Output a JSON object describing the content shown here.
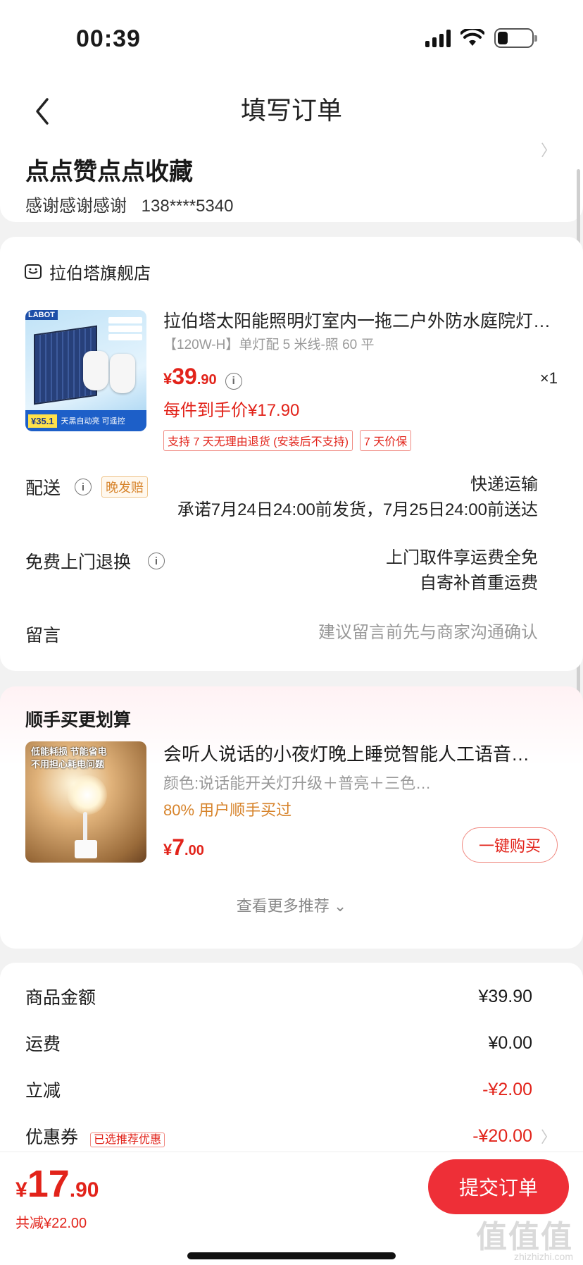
{
  "status_bar": {
    "time": "00:39"
  },
  "nav": {
    "title": "填写订单"
  },
  "address": {
    "name": "点点赞点点收藏",
    "contact": "感谢感谢感谢",
    "phone": "138****5340"
  },
  "shop": {
    "name": "拉伯塔旗舰店",
    "product": {
      "title": "拉伯塔太阳能照明灯室内一拖二户外防水庭院灯…",
      "spec": "【120W-H】单灯配 5 米线-照 60 平",
      "price_currency": "¥",
      "price_int": "39",
      "price_dec": ".90",
      "qty": "×1",
      "final_price": "每件到手价¥17.90",
      "image_badge_text": "LABOT",
      "image_price": "¥35.1",
      "image_slogan": "天黑自动亮 可遥控",
      "tags": [
        "支持 7 天无理由退货 (安装后不支持)",
        "7 天价保"
      ]
    },
    "delivery": {
      "label": "配送",
      "late_tag": "晚发赔",
      "method": "快递运输",
      "promise": "承诺7月24日24:00前发货，7月25日24:00前送达"
    },
    "return": {
      "label": "免费上门退换",
      "line1": "上门取件享运费全免",
      "line2": "自寄补首重运费"
    },
    "message": {
      "label": "留言",
      "placeholder": "建议留言前先与商家沟通确认"
    }
  },
  "upsell": {
    "title": "顺手买更划算",
    "image_text_line1": "低能耗损 节能省电",
    "image_text_line2": "不用担心耗电问题",
    "product_title": "会听人说话的小夜灯晚上睡觉智能人工语音…",
    "spec": "颜色:说话能开关灯升级＋普亮＋三色…",
    "bought": "80% 用户顺手买过",
    "price_currency": "¥",
    "price_int": "7",
    "price_dec": ".00",
    "buy_label": "一键购买",
    "more_label": "查看更多推荐 ⌄"
  },
  "summary": {
    "items": [
      {
        "label": "商品金额",
        "value": "¥39.90",
        "red": false
      },
      {
        "label": "运费",
        "value": "¥0.00",
        "red": false
      },
      {
        "label": "立减",
        "value": "-¥2.00",
        "red": true
      },
      {
        "label": "优惠券",
        "value": "-¥20.00",
        "red": true,
        "tag": "已选推荐优惠"
      }
    ]
  },
  "bottom": {
    "total_currency": "¥",
    "total_int": "17",
    "total_dec": ".90",
    "saved": "共减¥22.00",
    "submit_label": "提交订单",
    "watermark": "值值值",
    "watermark_sub": "zhizhizhi.com"
  },
  "colors": {
    "accent": "#e2231a",
    "button": "#ee2f37",
    "orange": "#d7842c"
  }
}
